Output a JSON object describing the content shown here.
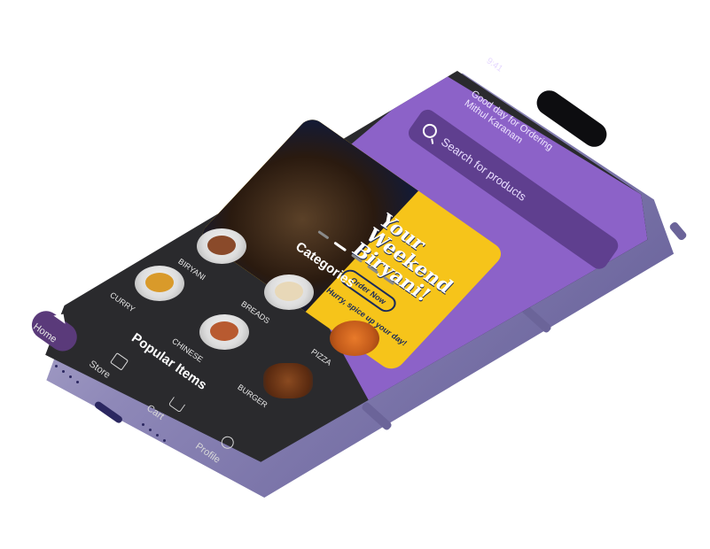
{
  "status": {
    "time": "9:41"
  },
  "header": {
    "greeting": "Good day for Ordering",
    "user_name": "Mithul Karanam"
  },
  "search": {
    "placeholder": "Search for products"
  },
  "banner": {
    "title": "Your Weekend Biryani!",
    "button_label": "Order Now",
    "tagline": "Hurry, spice up your day!"
  },
  "categories": {
    "title": "Categories",
    "items": [
      "BIRYANI",
      "CURRY",
      "BREADS",
      "CHINESE",
      "PIZZA",
      "BURGER"
    ]
  },
  "popular": {
    "title": "Popular Items"
  },
  "nav": {
    "home": "Home",
    "store": "Store",
    "cart": "Cart",
    "profile": "Profile"
  },
  "colors": {
    "accent_purple": "#8c62c8",
    "dark_bg": "#2a2a2d",
    "banner_yellow": "#f6c41a"
  }
}
